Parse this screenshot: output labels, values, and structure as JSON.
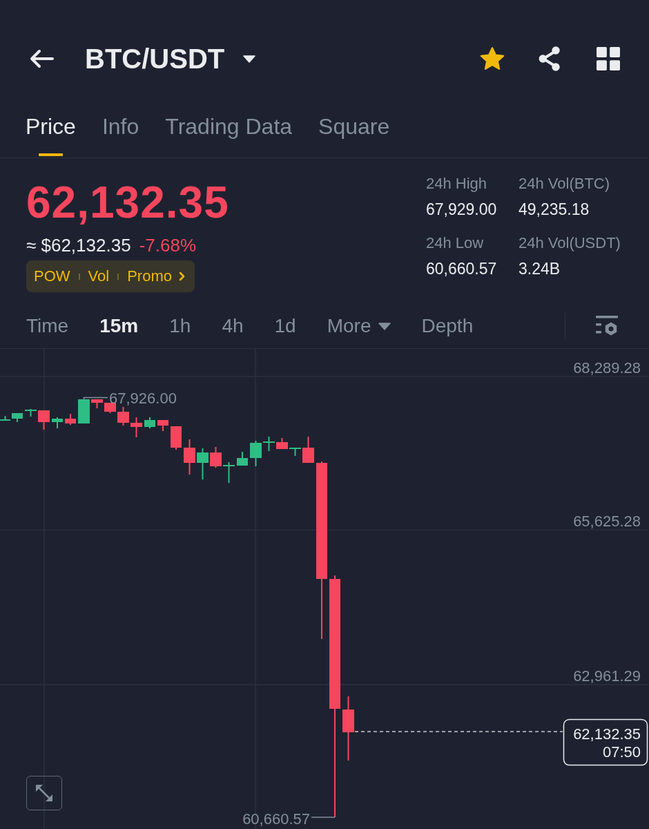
{
  "header": {
    "title": "BTC/USDT",
    "favorite": true
  },
  "tabs": [
    {
      "label": "Price",
      "selected": true
    },
    {
      "label": "Info",
      "selected": false
    },
    {
      "label": "Trading Data",
      "selected": false
    },
    {
      "label": "Square",
      "selected": false
    }
  ],
  "ticker": {
    "price": "62,132.35",
    "falling": true,
    "approx": "≈ $62,132.35",
    "change": "-7.68%",
    "tags": [
      "POW",
      "Vol",
      "Promo"
    ]
  },
  "stats": [
    {
      "label": "24h High",
      "value": "67,929.00"
    },
    {
      "label": "24h Vol(BTC)",
      "value": "49,235.18"
    },
    {
      "label": "24h Low",
      "value": "60,660.57"
    },
    {
      "label": "24h Vol(USDT)",
      "value": "3.24B"
    }
  ],
  "intervals": [
    {
      "label": "Time",
      "kind": "option",
      "selected": false
    },
    {
      "label": "15m",
      "kind": "option",
      "selected": true
    },
    {
      "label": "1h",
      "kind": "option",
      "selected": false
    },
    {
      "label": "4h",
      "kind": "option",
      "selected": false
    },
    {
      "label": "1d",
      "kind": "option",
      "selected": false
    },
    {
      "label": "More",
      "kind": "dropdown",
      "selected": false
    },
    {
      "label": "Depth",
      "kind": "option",
      "selected": false
    }
  ],
  "chart": {
    "y_axis_labels": [
      "68,289.28",
      "65,625.28",
      "62,961.29"
    ],
    "high_label": "67,926.00",
    "low_label": "60,660.57",
    "last_price": "62,132.35",
    "countdown": "07:50"
  }
}
